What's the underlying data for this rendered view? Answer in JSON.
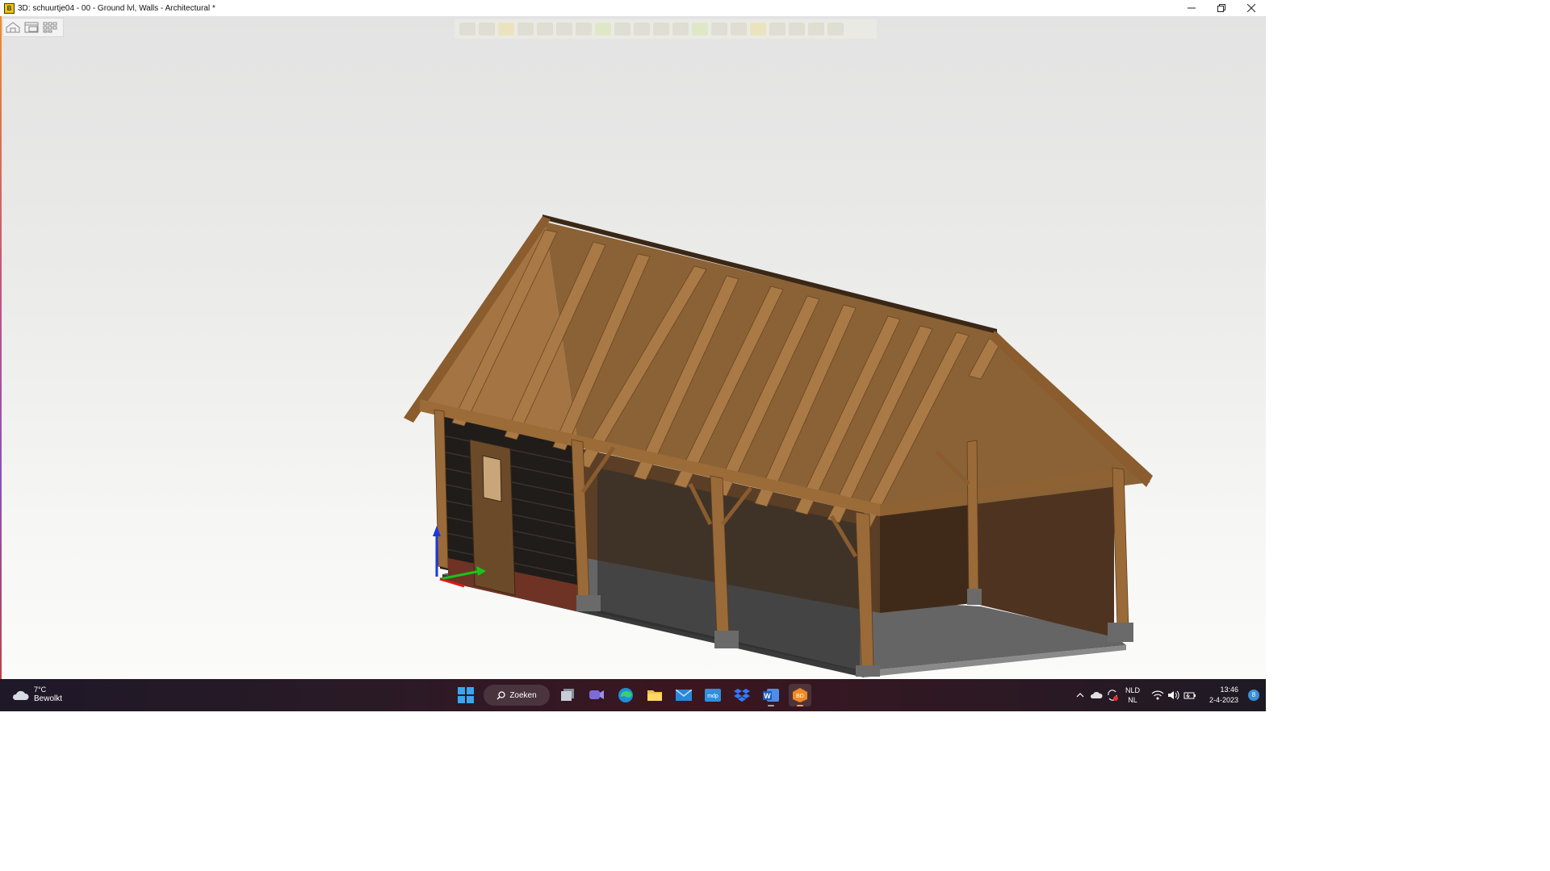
{
  "window": {
    "title": "3D: schuurtje04 - 00 - Ground lvl, Walls - Architectural *",
    "controls": [
      "minimize",
      "restore",
      "close"
    ]
  },
  "view_tools": [
    "home-view-icon",
    "window-view-icon",
    "tile-view-icon"
  ],
  "model": {
    "description_colors": {
      "timber": "#9b6e3e",
      "dark_cladding": "#1f1c1a",
      "floor": "#6b6b6b",
      "brick": "#7a3a2a"
    }
  },
  "taskbar": {
    "weather": {
      "temperature": "7°C",
      "condition": "Bewolkt"
    },
    "search_label": "Zoeken",
    "apps": [
      "start-icon",
      "search",
      "task-view-icon",
      "teams-icon",
      "edge-icon",
      "file-explorer-icon",
      "mail-icon",
      "mdp-app-icon",
      "dropbox-icon",
      "word-icon",
      "3d-app-icon"
    ],
    "language": {
      "top": "NLD",
      "bottom": "NL"
    },
    "clock": {
      "time": "13:46",
      "date": "2-4-2023"
    },
    "notification_count": "8"
  }
}
